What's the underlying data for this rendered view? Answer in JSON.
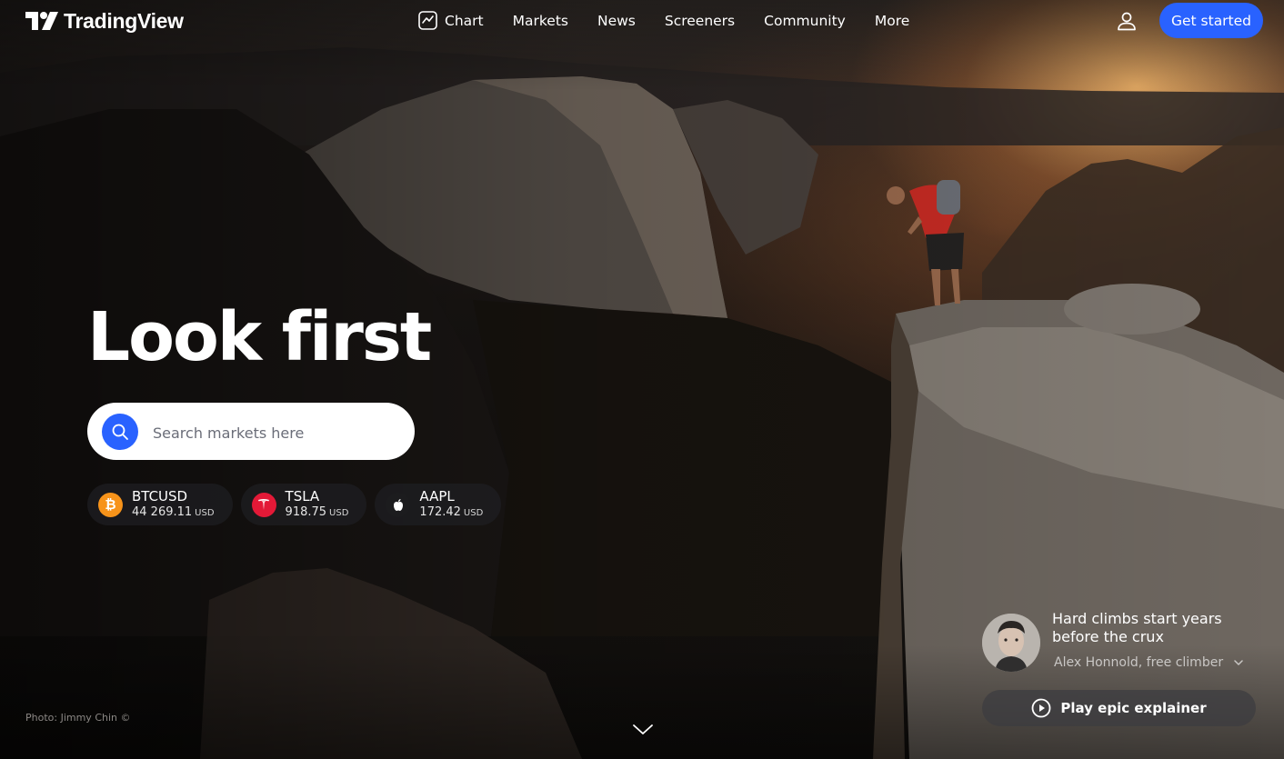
{
  "brand": {
    "name": "TradingView"
  },
  "nav": {
    "items": [
      {
        "label": "Chart",
        "icon": "chart-icon"
      },
      {
        "label": "Markets"
      },
      {
        "label": "News"
      },
      {
        "label": "Screeners"
      },
      {
        "label": "Community"
      },
      {
        "label": "More"
      }
    ],
    "user_icon": "user-icon",
    "cta_label": "Get started"
  },
  "hero": {
    "headline": "Look first",
    "search_placeholder": "Search markets here",
    "tickers": [
      {
        "symbol": "BTCUSD",
        "price": "44 269.11",
        "currency": "USD",
        "icon": "bitcoin-icon",
        "color": "#f7931a"
      },
      {
        "symbol": "TSLA",
        "price": "918.75",
        "currency": "USD",
        "icon": "tesla-icon",
        "color": "#e31937"
      },
      {
        "symbol": "AAPL",
        "price": "172.42",
        "currency": "USD",
        "icon": "apple-icon",
        "color": "#1c1c1e"
      }
    ]
  },
  "quote": {
    "text": "Hard climbs start years before the crux",
    "author": "Alex Honnold, free climber",
    "play_label": "Play epic explainer"
  },
  "photo_credit": "Photo: Jimmy Chin ©",
  "colors": {
    "accent": "#2962ff",
    "background": "#151210"
  }
}
